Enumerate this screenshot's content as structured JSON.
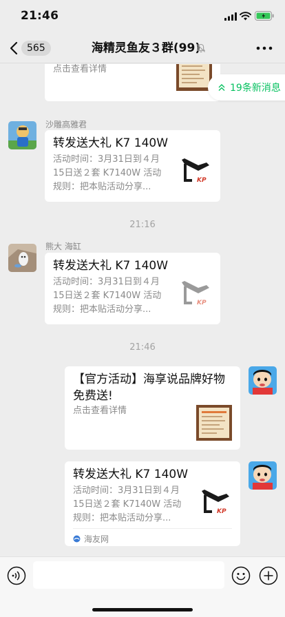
{
  "status_bar": {
    "time": "21:46"
  },
  "header": {
    "back_count": "565",
    "title": "海精灵鱼友３群(99)"
  },
  "new_messages_label": "19条新消息",
  "messages": [
    {
      "type": "card_partial",
      "desc": "点击查看详情"
    },
    {
      "type": "card",
      "sender": "沙雕高雅君",
      "title": "转发送大礼 K7 140W",
      "desc_lines": [
        "活动时间：3月31日到４月",
        "15日送２套 K7140W 活动",
        "规则：把本贴活动分享..."
      ],
      "thumb_brand": "KP"
    },
    {
      "type": "time",
      "text": "21:16"
    },
    {
      "type": "card",
      "sender": "熊大 海缸",
      "title": "转发送大礼 K7 140W",
      "desc_lines": [
        "活动时间：3月31日到４月",
        "15日送２套 K7140W 活动",
        "规则：把本贴活动分享..."
      ],
      "thumb_brand": "KP"
    },
    {
      "type": "time",
      "text": "21:46"
    },
    {
      "type": "card_self",
      "title_lines": [
        "【官方活动】海享说品牌好物",
        "免费送!"
      ],
      "desc": "点击查看详情"
    },
    {
      "type": "card_self",
      "title": "转发送大礼 K7 140W",
      "desc_lines": [
        "活动时间：3月31日到４月",
        "15日送２套 K7140W 活动",
        "规则：把本贴活动分享..."
      ],
      "thumb_brand": "KP",
      "source": "海友网"
    }
  ],
  "colors": {
    "accent_green": "#07c160",
    "background": "#ededed",
    "card": "#ffffff"
  },
  "icons": [
    "back-icon",
    "mute-icon",
    "more-icon",
    "signal-icon",
    "wifi-icon",
    "battery-icon",
    "voice-icon",
    "emoji-icon",
    "plus-icon",
    "double-chevron-up-icon"
  ]
}
